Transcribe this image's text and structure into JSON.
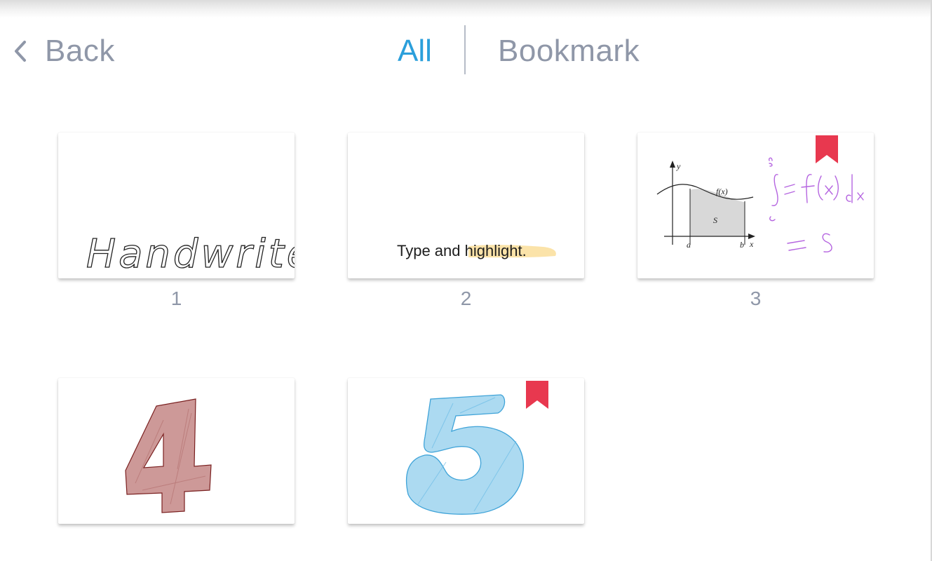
{
  "header": {
    "back_label": "Back",
    "tabs": [
      {
        "label": "All",
        "active": true
      },
      {
        "label": "Bookmark",
        "active": false
      }
    ]
  },
  "pages": [
    {
      "number": "1",
      "text": "Handwrite",
      "bookmarked": false
    },
    {
      "number": "2",
      "text_plain": "Type and ",
      "text_highlight": "highlight.",
      "bookmarked": false
    },
    {
      "number": "3",
      "formula_labels": {
        "y": "y",
        "x": "x",
        "a": "a",
        "b": "b",
        "fx": "f(x)",
        "s": "S"
      },
      "handwriting": "∫ = f(x)dx",
      "bookmarked": true
    },
    {
      "number": "4",
      "glyph": "4",
      "bookmarked": false
    },
    {
      "number": "5",
      "glyph": "5",
      "bookmarked": true
    }
  ],
  "colors": {
    "accent": "#2b9fdb",
    "muted_text": "#8f97a8",
    "bookmark": "#e8384f",
    "highlight": "#fbe0a0",
    "page4_fill": "#c9908f",
    "page5_fill": "#a8d8f0"
  }
}
